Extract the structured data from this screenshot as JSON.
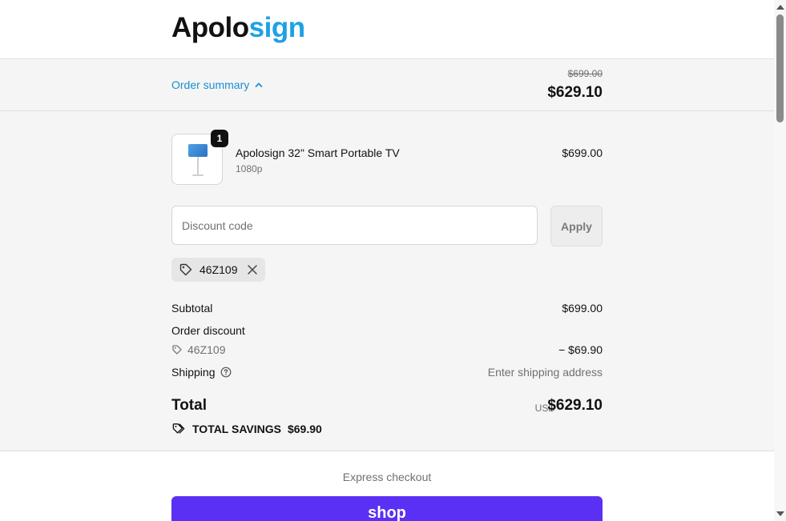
{
  "brand": {
    "part1": "Apolo",
    "part2": "sign",
    "accent_color": "#1da1e6"
  },
  "summary": {
    "toggle_label": "Order summary",
    "toggle_icon": "chevron-up-icon",
    "original_price": "$699.00",
    "discounted_price": "$629.10"
  },
  "line_item": {
    "quantity": "1",
    "title": "Apolosign 32\" Smart Portable TV",
    "variant": "1080p",
    "price": "$699.00"
  },
  "discount": {
    "placeholder": "Discount code",
    "apply_label": "Apply",
    "applied_code": "46Z109"
  },
  "totals": {
    "subtotal_label": "Subtotal",
    "subtotal_value": "$699.00",
    "order_discount_label": "Order discount",
    "discount_code": "46Z109",
    "discount_value": "− $69.90",
    "shipping_label": "Shipping",
    "shipping_value": "Enter shipping address",
    "total_label": "Total",
    "currency": "USD",
    "total_value": "$629.10",
    "savings_label": "TOTAL SAVINGS",
    "savings_value": "$69.90"
  },
  "express": {
    "title": "Express checkout",
    "shop_label": "shop",
    "shop_color": "#5a31f4"
  }
}
